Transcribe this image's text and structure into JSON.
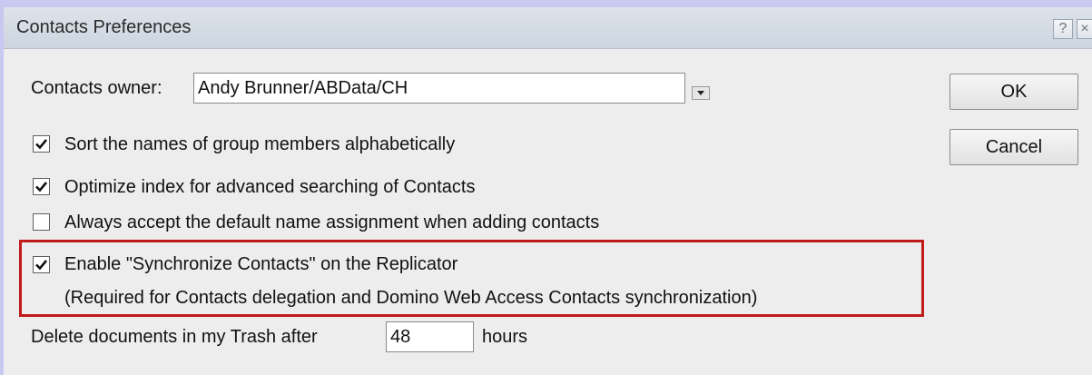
{
  "window": {
    "title": "Contacts Preferences",
    "help_label": "?",
    "close_label": "×"
  },
  "owner": {
    "label": "Contacts owner:",
    "value": "Andy Brunner/ABData/CH"
  },
  "options": [
    {
      "label": "Sort the names of group members alphabetically",
      "checked": true
    },
    {
      "label": "Optimize index for advanced searching of Contacts",
      "checked": true
    },
    {
      "label": "Always accept the default name assignment when adding contacts",
      "checked": false
    },
    {
      "label": "Enable \"Synchronize Contacts\" on the Replicator",
      "checked": true
    }
  ],
  "sync_note": "(Required for Contacts delegation and Domino Web Access Contacts synchronization)",
  "trash": {
    "label_before": "Delete documents in my Trash after",
    "value": "48",
    "label_after": "hours"
  },
  "buttons": {
    "ok": "OK",
    "cancel": "Cancel"
  },
  "colors": {
    "highlight": "#c01c1c",
    "background": "#c8c8f0"
  }
}
